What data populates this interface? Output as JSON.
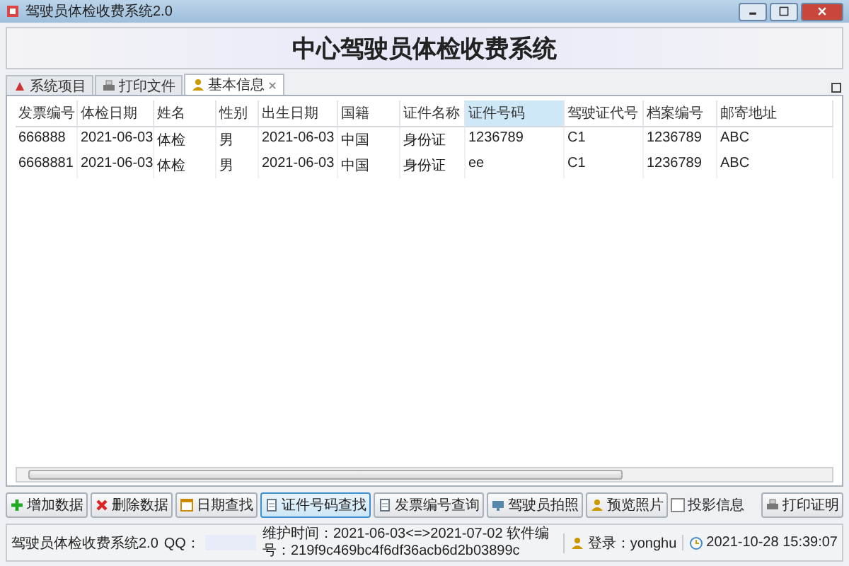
{
  "window": {
    "title": "驾驶员体检收费系统2.0"
  },
  "header": {
    "title": "中心驾驶员体检收费系统"
  },
  "tabs": [
    {
      "label": "系统项目",
      "selected": false
    },
    {
      "label": "打印文件",
      "selected": false
    },
    {
      "label": "基本信息",
      "selected": true
    }
  ],
  "table": {
    "columns": [
      {
        "label": "发票编号",
        "sorted": false
      },
      {
        "label": "体检日期",
        "sorted": false
      },
      {
        "label": "姓名",
        "sorted": false
      },
      {
        "label": "性别",
        "sorted": false
      },
      {
        "label": "出生日期",
        "sorted": false
      },
      {
        "label": "国籍",
        "sorted": false
      },
      {
        "label": "证件名称",
        "sorted": false
      },
      {
        "label": "证件号码",
        "sorted": true
      },
      {
        "label": "驾驶证代号",
        "sorted": false
      },
      {
        "label": "档案编号",
        "sorted": false
      },
      {
        "label": "邮寄地址",
        "sorted": false
      }
    ],
    "rows": [
      [
        "666888",
        "2021-06-03",
        "体检",
        "男",
        "2021-06-03",
        "中国",
        "身份证",
        "1236789",
        "C1",
        "1236789",
        "ABC"
      ],
      [
        "6668881",
        "2021-06-03",
        "体检",
        "男",
        "2021-06-03",
        "中国",
        "身份证",
        "ee",
        "C1",
        "1236789",
        "ABC"
      ]
    ]
  },
  "toolbar": {
    "buttons": [
      {
        "label": "增加数据",
        "selected": false
      },
      {
        "label": "删除数据",
        "selected": false
      },
      {
        "label": "日期查找",
        "selected": false
      },
      {
        "label": "证件号码查找",
        "selected": true
      },
      {
        "label": "发票编号查询",
        "selected": false
      },
      {
        "label": "驾驶员拍照",
        "selected": false
      },
      {
        "label": "预览照片",
        "selected": false
      }
    ],
    "checkbox": {
      "label": "投影信息",
      "checked": false
    },
    "print_button": {
      "label": "打印证明"
    }
  },
  "status_bar": {
    "app": "驾驶员体检收费系统2.0",
    "qq_label": "QQ：",
    "info": "维护时间：2021-06-03<=>2021-07-02 软件编号：219f9c469bc4f6df36acb6d2b03899c",
    "login": "登录：yonghu",
    "datetime": "2021-10-28 15:39:07"
  }
}
